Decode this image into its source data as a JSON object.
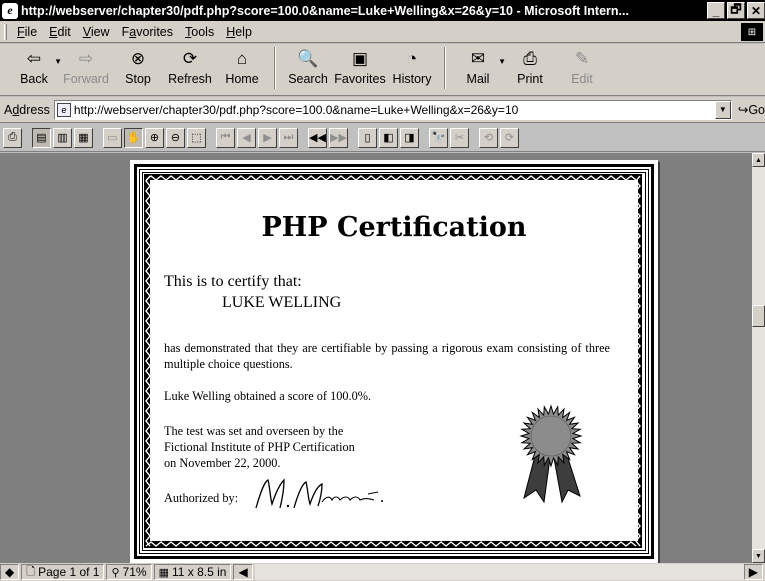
{
  "window": {
    "title": "http://webserver/chapter30/pdf.php?score=100.0&name=Luke+Welling&x=26&y=10 - Microsoft Intern...",
    "minimize": "_",
    "restore": "🗗",
    "close": "✕"
  },
  "menu": {
    "items": [
      {
        "key": "F",
        "rest": "ile"
      },
      {
        "key": "E",
        "rest": "dit"
      },
      {
        "key": "V",
        "rest": "iew"
      },
      {
        "pre": "F",
        "key": "a",
        "rest": "vorites"
      },
      {
        "key": "T",
        "rest": "ools"
      },
      {
        "key": "H",
        "rest": "elp"
      }
    ]
  },
  "toolbar": {
    "back": "Back",
    "forward": "Forward",
    "stop": "Stop",
    "refresh": "Refresh",
    "home": "Home",
    "search": "Search",
    "favorites": "Favorites",
    "history": "History",
    "mail": "Mail",
    "print": "Print",
    "edit": "Edit"
  },
  "address": {
    "label_key": "d",
    "label_pre": "A",
    "label_rest": "dress",
    "url": "http://webserver/chapter30/pdf.php?score=100.0&name=Luke+Welling&x=26&y=10",
    "go": "Go"
  },
  "certificate": {
    "title": "PHP Certification",
    "certify_line": "This is to certify that:",
    "name": "LUKE WELLING",
    "demonstrated": "has demonstrated that they are certifiable by passing a rigorous exam consisting of three multiple choice questions.",
    "score_line": "Luke Welling obtained a score of 100.0%.",
    "test_line1": "The test was set and overseen by the",
    "test_line2": "Fictional Institute of PHP Certification",
    "test_line3": "on November 22, 2000.",
    "authorized": "Authorized by:"
  },
  "status": {
    "page": "Page 1 of 1",
    "zoom": "71%",
    "size": "11 x 8.5 in"
  }
}
